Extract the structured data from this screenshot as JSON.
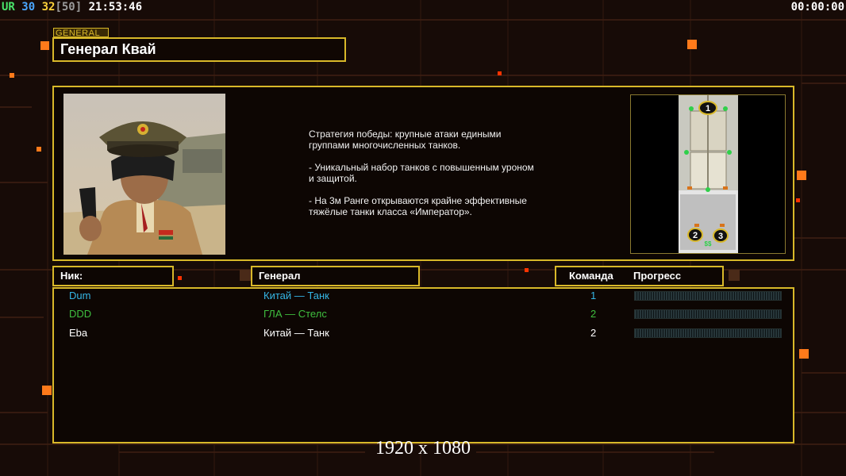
{
  "hud": {
    "ur_label": "UR",
    "fps": "30",
    "target_fps": "32",
    "fps_cap": "[50]",
    "clock": "21:53:46",
    "timer": "00:00:00"
  },
  "header": {
    "tab_label": "GENERAL",
    "general_name": "Генерал Квай"
  },
  "description": [
    "Стратегия победы: крупные атаки едиными\n группами многочисленных танков.",
    "- Уникальный набор танков с повышенным уроном\n и защитой.",
    "- На 3м Ранге открываются крайне эффективные\n тяжёлые танки класса «Император»."
  ],
  "minimap": {
    "slots": [
      "1",
      "2",
      "3"
    ],
    "center_label": "$$"
  },
  "columns": {
    "nick": "Ник:",
    "general": "Генерал",
    "team": "Команда",
    "progress": "Прогресс"
  },
  "players": [
    {
      "nick": "Dum",
      "general": "Китай — Танк",
      "team": "1",
      "color": "#35b6e6",
      "progress": 0
    },
    {
      "nick": "DDD",
      "general": "ГЛА — Стелс",
      "team": "2",
      "color": "#3fbf3f",
      "progress": 0
    },
    {
      "nick": "Eba",
      "general": "Китай — Танк",
      "team": "2",
      "color": "#ffffff",
      "progress": 0
    }
  ],
  "resolution": "1920 x 1080",
  "colors": {
    "frame": "#d8b829",
    "accent_orange": "#ff7a1a",
    "background": "#170b07"
  }
}
